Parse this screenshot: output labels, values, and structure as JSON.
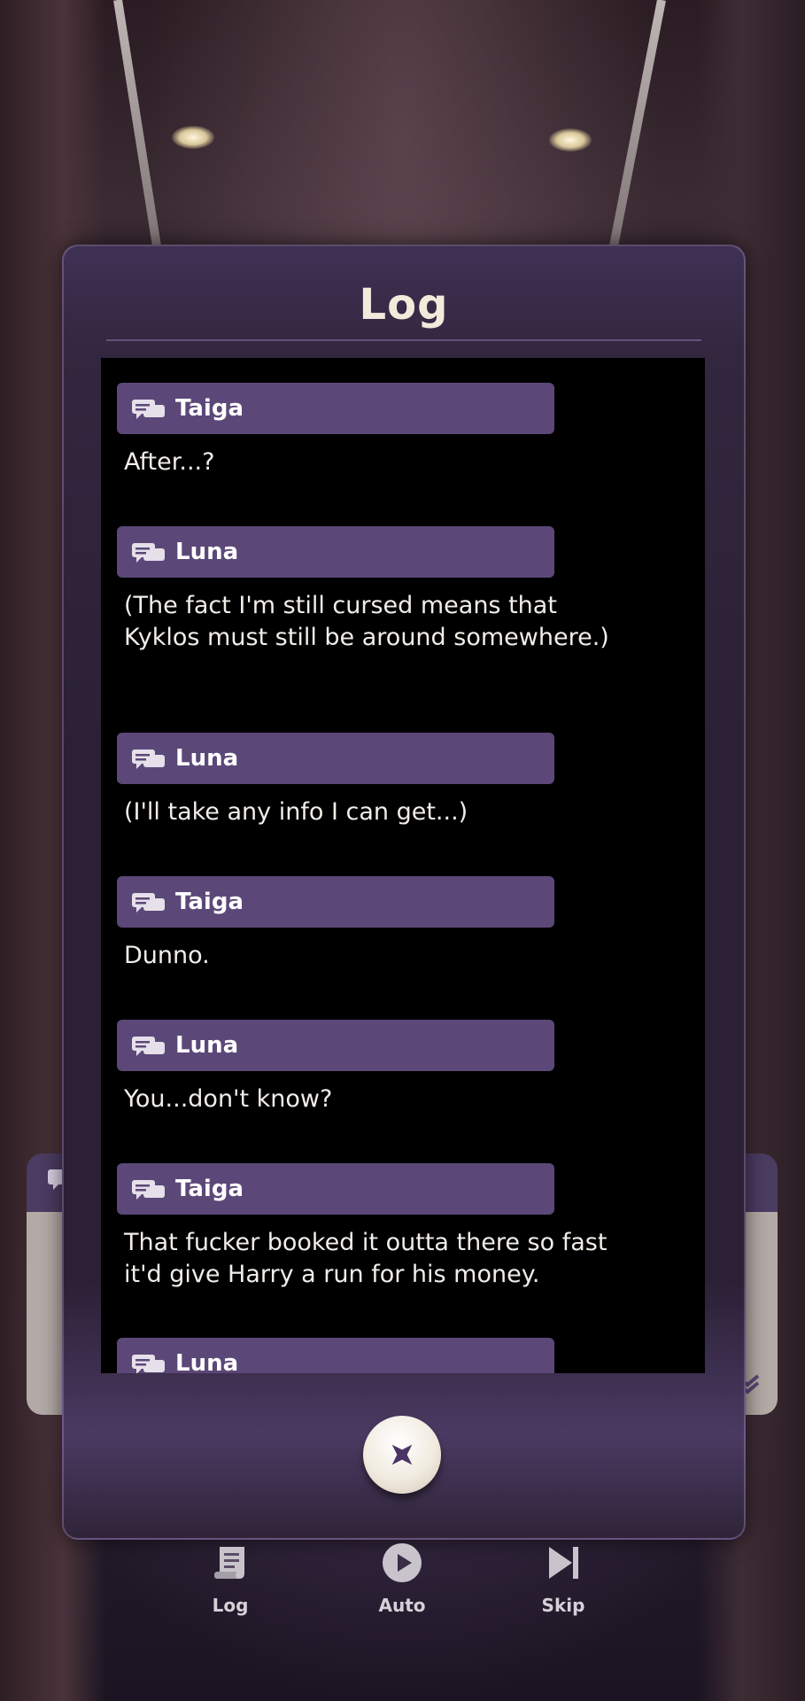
{
  "log_panel": {
    "title": "Log",
    "entries": [
      {
        "speaker": "Taiga",
        "text": "After...?"
      },
      {
        "speaker": "Luna",
        "text": "(The fact I'm still cursed means that Kyklos must still be around somewhere.)"
      },
      {
        "speaker": "Luna",
        "text": "(I'll take any info I can get...)"
      },
      {
        "speaker": "Taiga",
        "text": "Dunno."
      },
      {
        "speaker": "Luna",
        "text": "You...don't know?"
      },
      {
        "speaker": "Taiga",
        "text": "That fucker booked it outta there so fast it'd give Harry a run for his money."
      },
      {
        "speaker": "Luna",
        "text": ""
      }
    ],
    "close_icon": "close-x-icon"
  },
  "toolbar": {
    "log_label": "Log",
    "auto_label": "Auto",
    "skip_label": "Skip"
  },
  "colors": {
    "panel_bg": "#2b2035",
    "name_bar": "#5b4878",
    "log_bg": "#000000",
    "title_text": "#f3eadb"
  }
}
